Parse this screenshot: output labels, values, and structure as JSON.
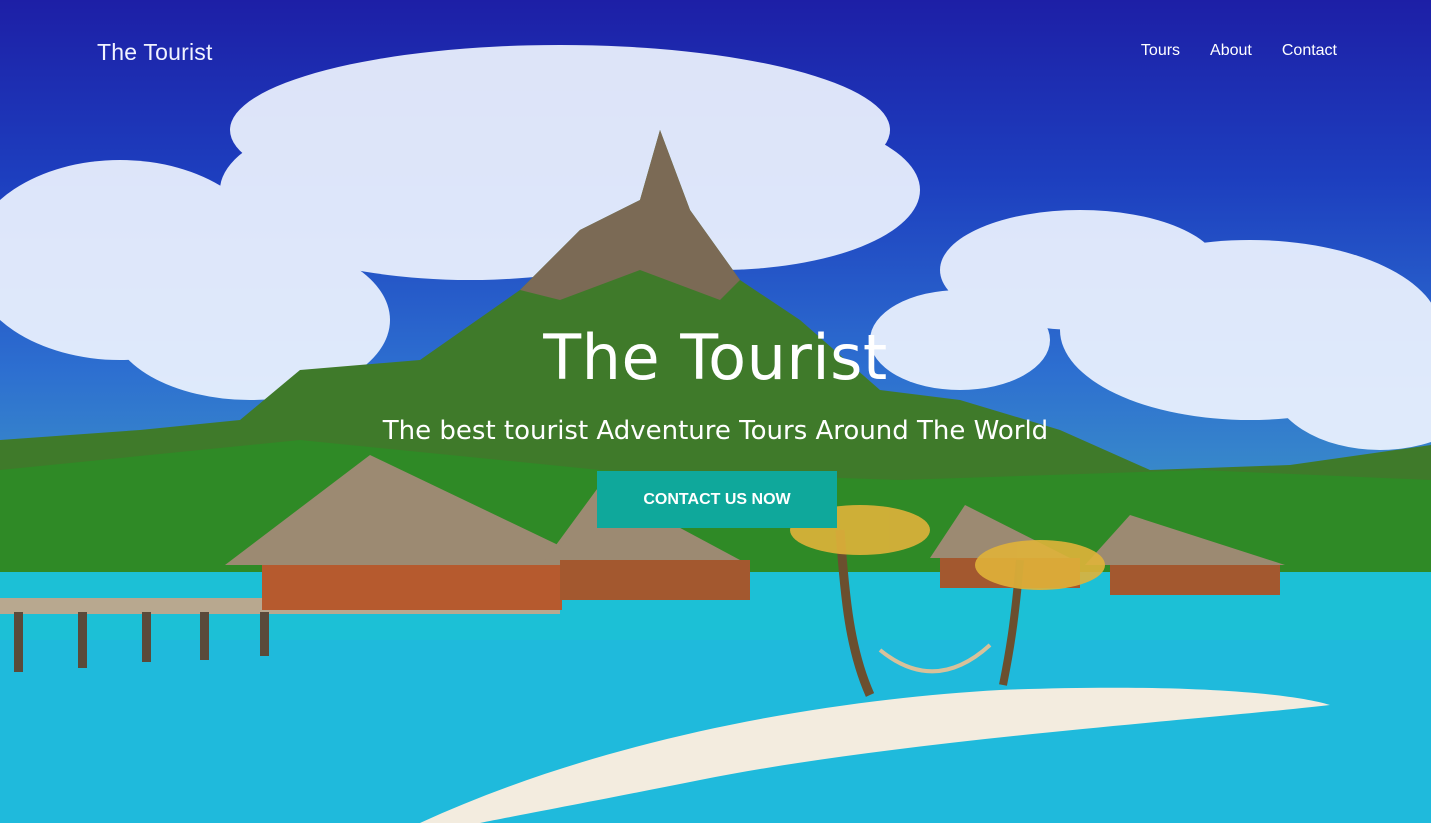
{
  "nav": {
    "brand": "The Tourist",
    "links": [
      "Tours",
      "About",
      "Contact"
    ]
  },
  "hero": {
    "title": "The Tourist",
    "subtitle": "The best tourist Adventure Tours Around The World",
    "cta_label": "CONTACT US NOW"
  },
  "colors": {
    "cta_background": "#0fa89b",
    "sky": "#1d3fbf",
    "lagoon": "#18c3d8"
  }
}
